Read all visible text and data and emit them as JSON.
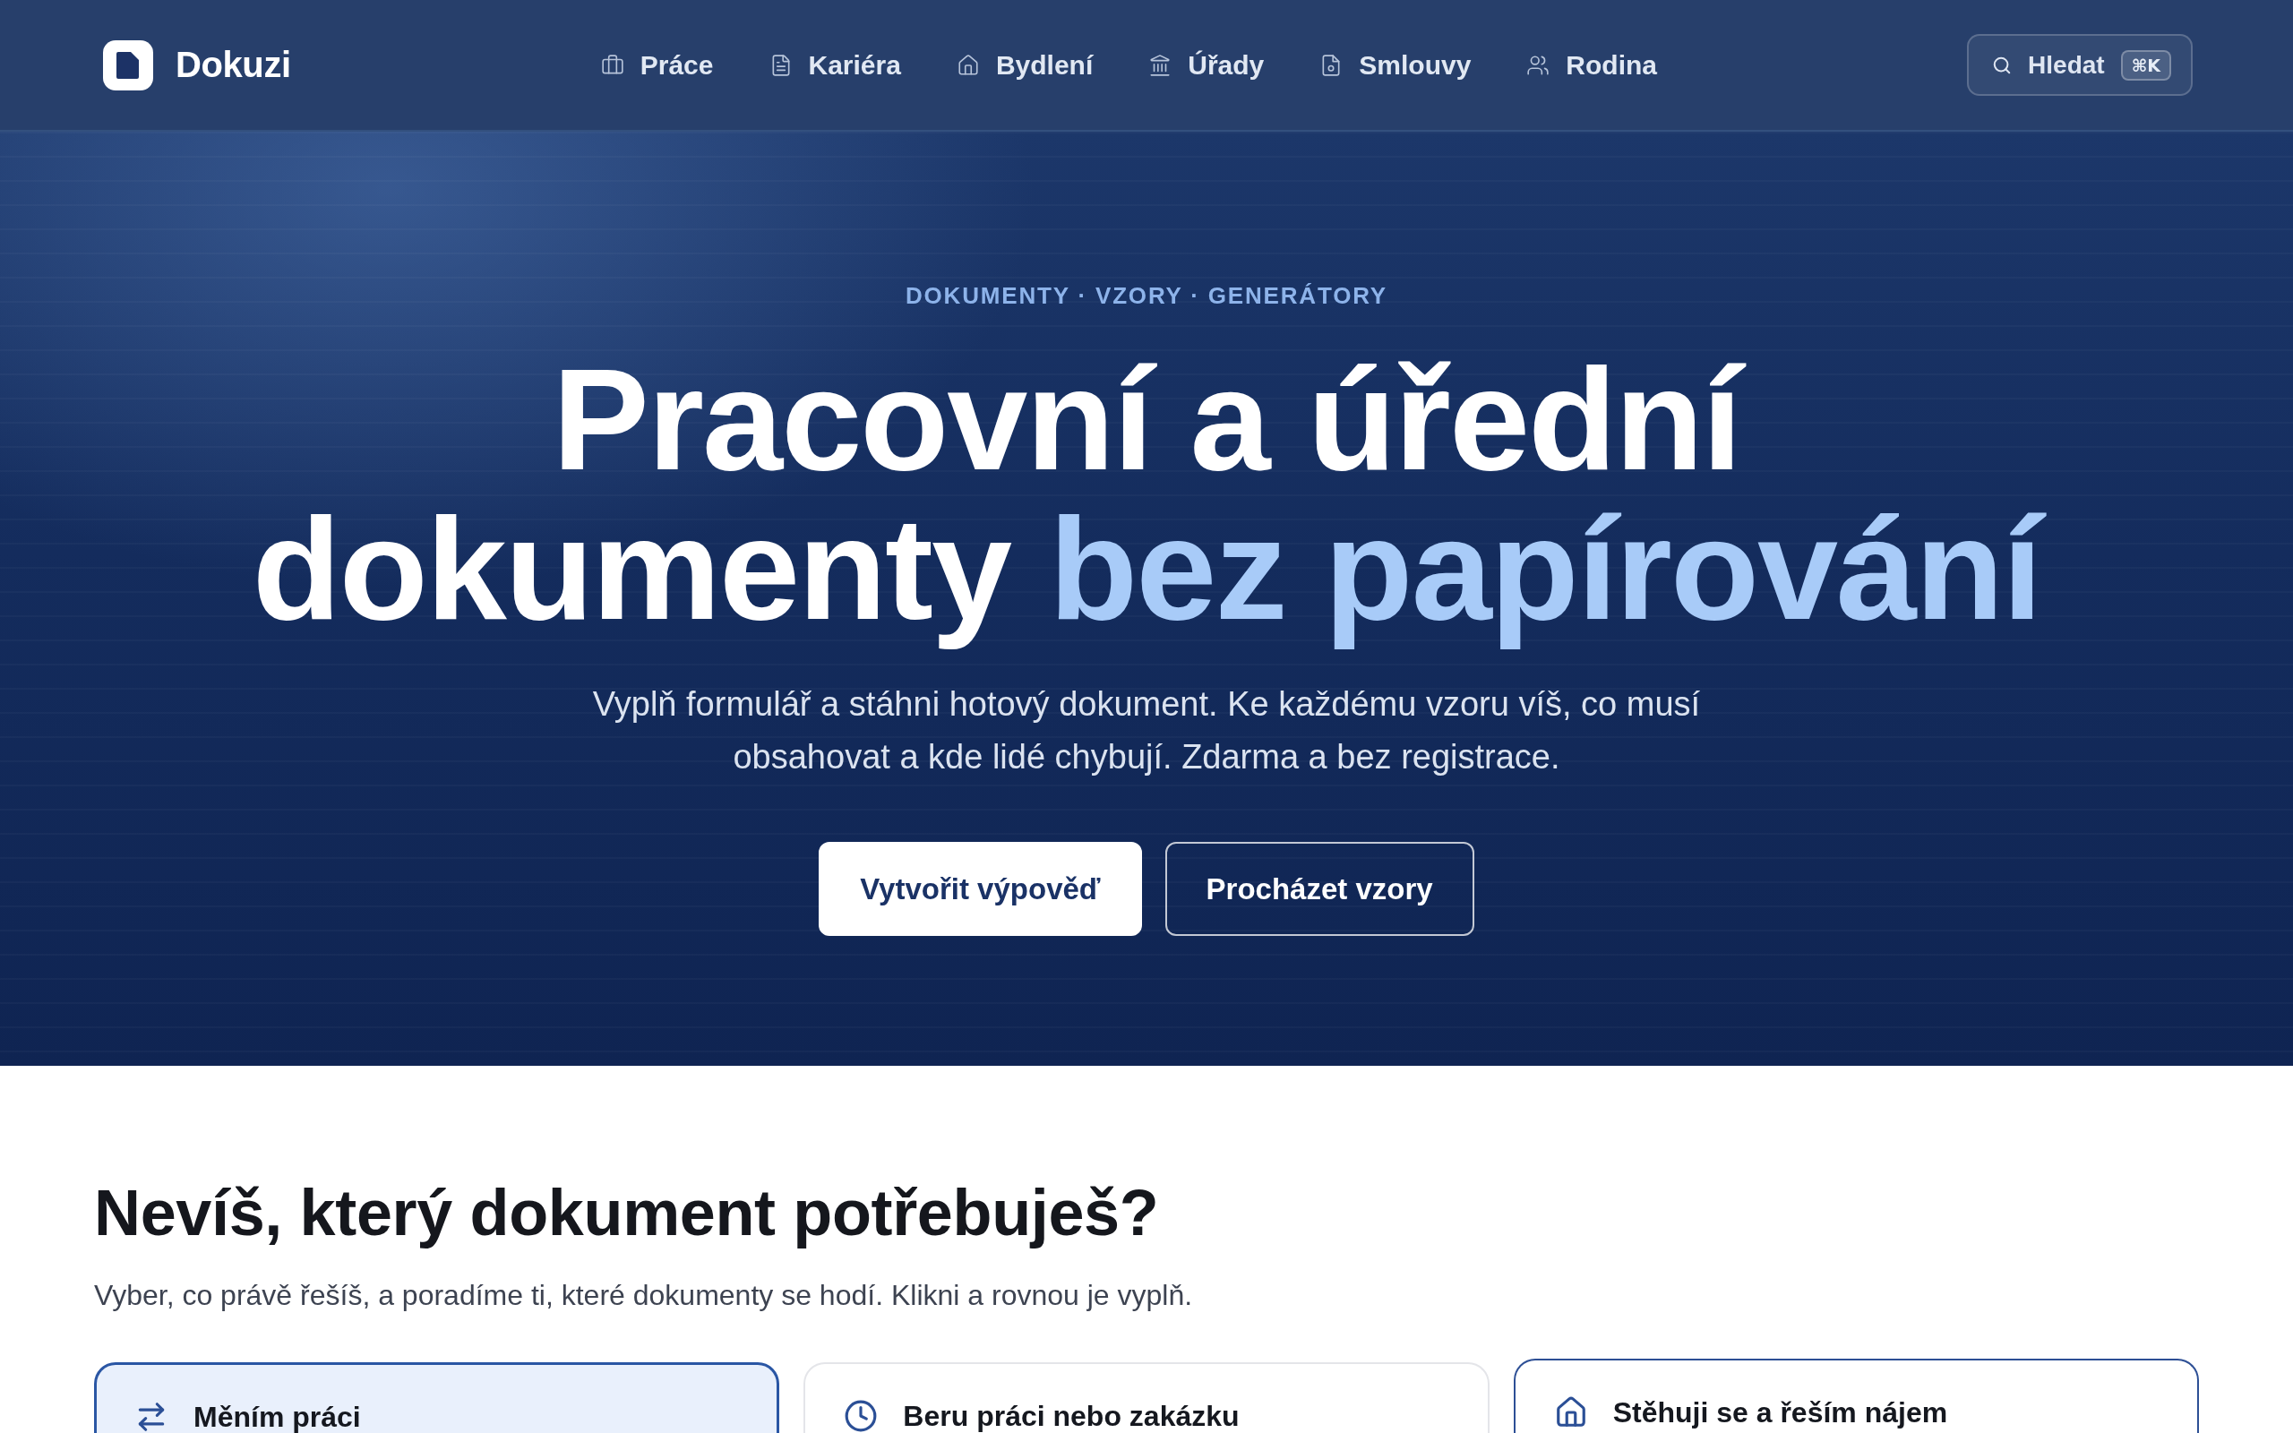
{
  "header": {
    "brand": "Dokuzi",
    "nav": [
      {
        "label": "Práce"
      },
      {
        "label": "Kariéra"
      },
      {
        "label": "Bydlení"
      },
      {
        "label": "Úřady"
      },
      {
        "label": "Smlouvy"
      },
      {
        "label": "Rodina"
      }
    ],
    "search": {
      "label": "Hledat",
      "shortcut": "⌘K"
    }
  },
  "hero": {
    "eyebrow": "DOKUMENTY · VZORY · GENERÁTORY",
    "title": "Pracovní a úřední dokumenty",
    "title_highlight": "bez papírování",
    "subtitle": "Vyplň formulář a stáhni hotový dokument. Ke každému vzoru víš, co musí obsahovat a kde lidé chybují. Zdarma a bez registrace.",
    "buttons": [
      {
        "label": "Vytvořit výpověď",
        "kind": "primary"
      },
      {
        "label": "Procházet vzory",
        "kind": "secondary"
      }
    ]
  },
  "finder": {
    "heading": "Nevíš, který dokument potřebuješ?",
    "intro": "Vyber, co právě řešíš, a poradíme ti, které dokumenty se hodí. Klikni a rovnou je vyplň.",
    "cards": [
      {
        "title": "Měním práci",
        "selected": true,
        "hovered": false
      },
      {
        "title": "Beru práci nebo zakázku",
        "selected": false,
        "hovered": false
      },
      {
        "title": "Stěhuji se a řeším nájem",
        "selected": false,
        "hovered": true
      }
    ]
  }
}
